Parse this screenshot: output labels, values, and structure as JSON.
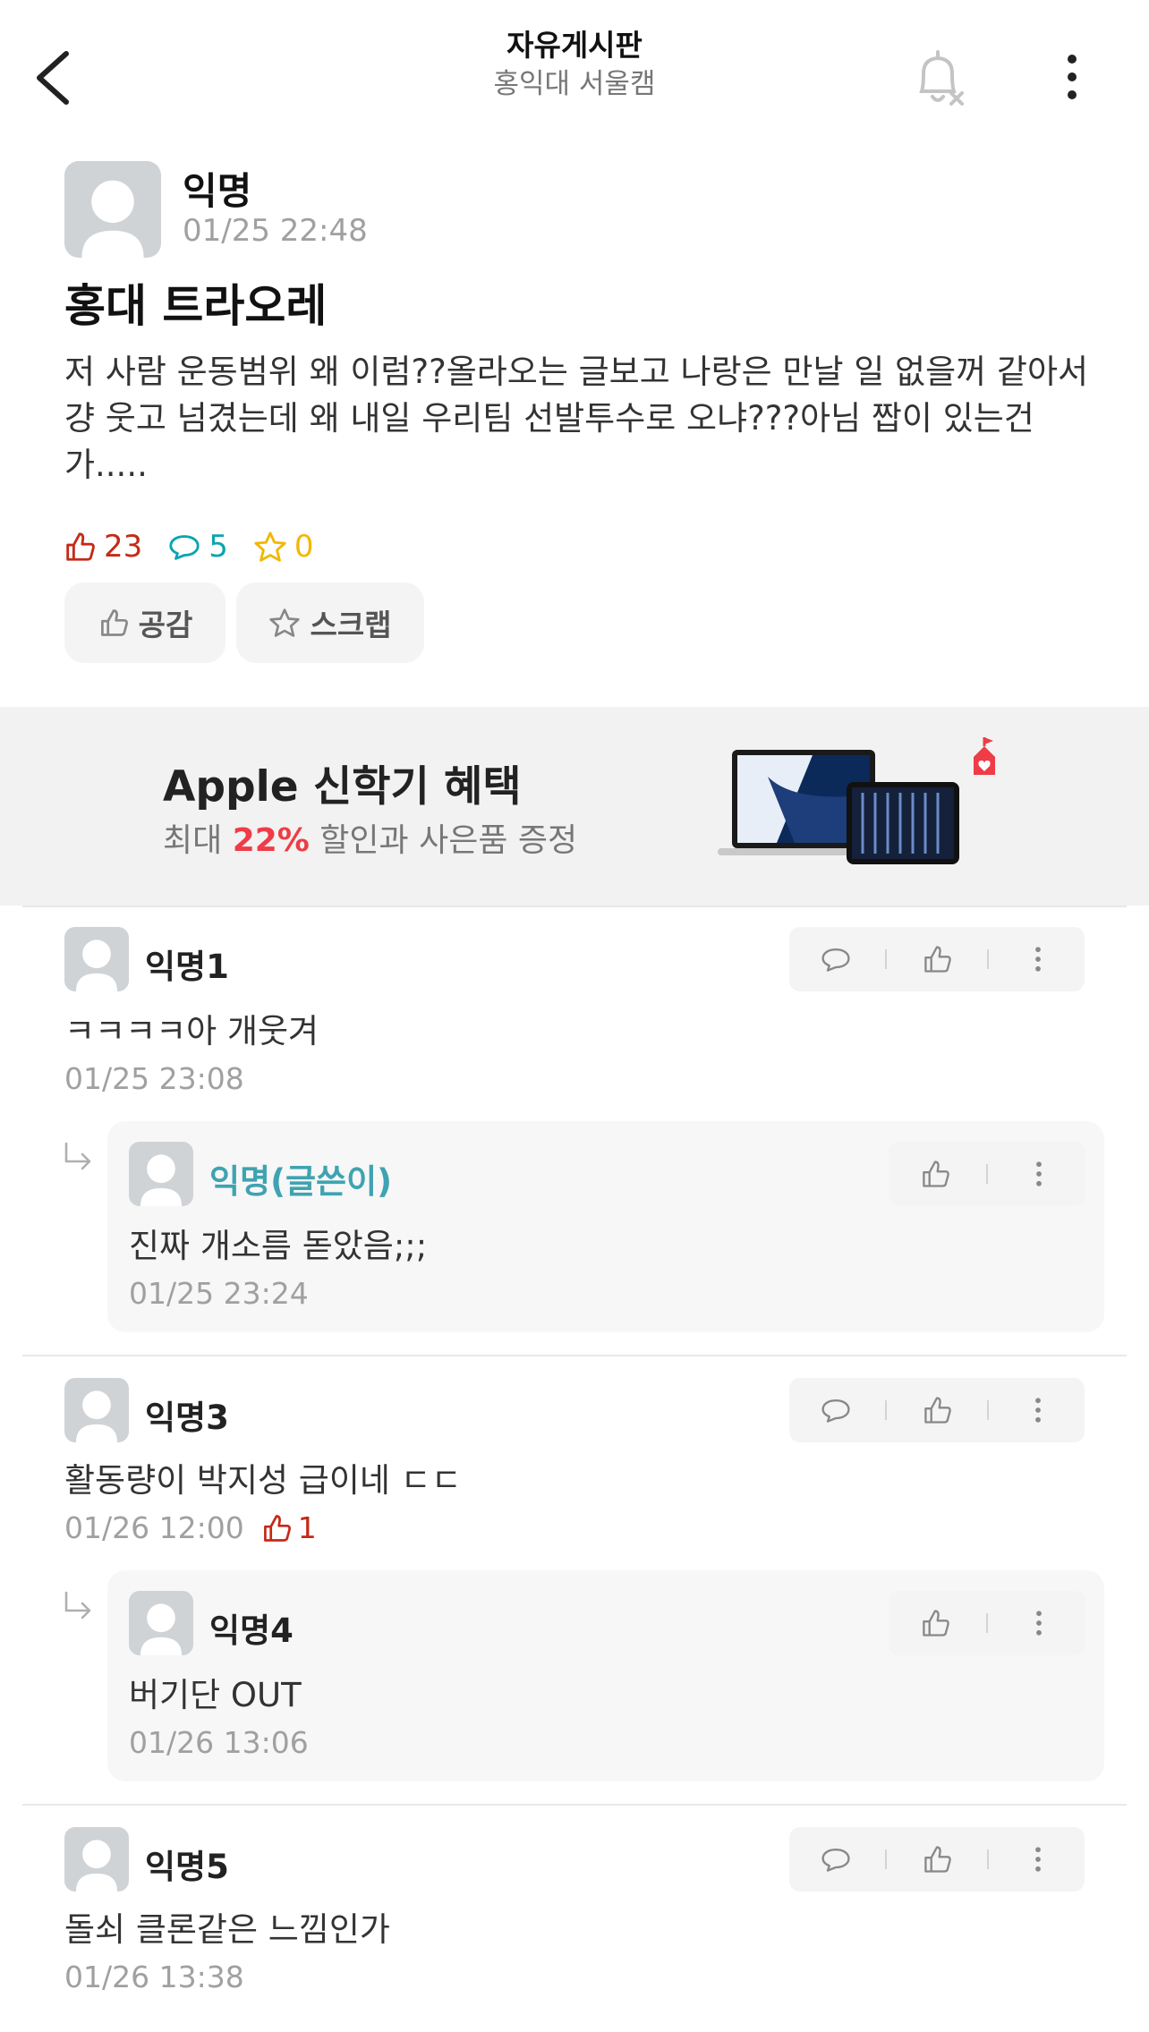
{
  "header": {
    "title": "자유게시판",
    "subtitle": "홍익대 서울캠"
  },
  "post": {
    "author": "익명",
    "time": "01/25 22:48",
    "title": "홍대 트라오레",
    "body": "저 사람 운동범위 왜 이럼??올라오는 글보고 나랑은 만날 일 없을꺼 같아서 걍 웃고 넘겼는데 왜 내일 우리팀 선발투수로 오냐???아님 짭이 있는건가.....",
    "likes": "23",
    "comments": "5",
    "scraps": "0",
    "like_button": "공감",
    "scrap_button": "스크랩"
  },
  "ad": {
    "title": "Apple 신학기 혜택",
    "sub_prefix": "최대 ",
    "sub_percent": "22%",
    "sub_suffix": " 할인과 사은품 증정"
  },
  "comments": [
    {
      "name": "익명1",
      "text": "ㅋㅋㅋㅋ아 개웃겨",
      "time": "01/25 23:08",
      "reply": {
        "name": "익명(글쓴이)",
        "text": "진짜 개소름 돋았음;;;",
        "time": "01/25 23:24"
      }
    },
    {
      "name": "익명3",
      "text": "활동량이 박지성 급이네 ㄷㄷ",
      "time": "01/26 12:00",
      "likes": "1",
      "reply": {
        "name": "익명4",
        "text": "버기단 OUT",
        "time": "01/26 13:06"
      }
    },
    {
      "name": "익명5",
      "text": "돌쇠 클론같은 느낌인가",
      "time": "01/26 13:38"
    }
  ],
  "icons": {
    "back": "chevron-left-icon",
    "notify_off": "bell-off-icon",
    "more": "more-vertical-icon",
    "like": "thumbs-up-icon",
    "comment": "comment-icon",
    "scrap": "star-icon",
    "reply": "reply-arrow-icon"
  },
  "colors": {
    "like": "#c62917",
    "comment": "#0ca5b0",
    "scrap": "#f2b705",
    "writer": "#3fa3b1",
    "ad_accent": "#ef3c46"
  }
}
